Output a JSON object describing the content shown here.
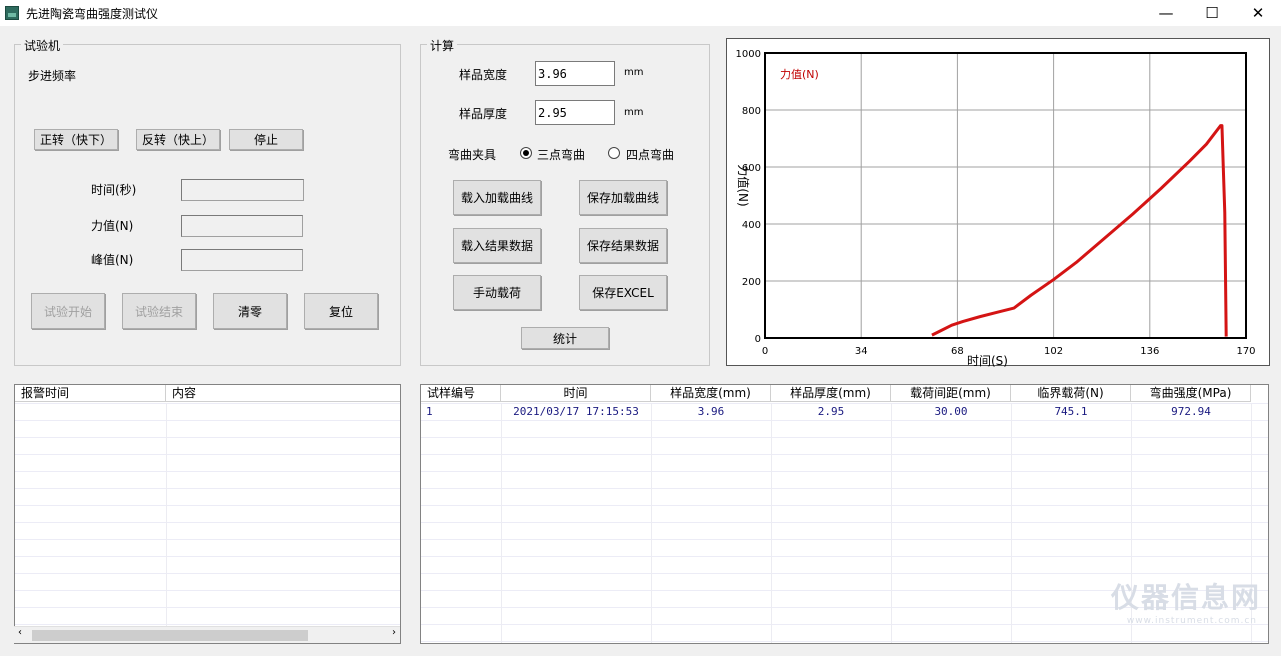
{
  "window": {
    "title": "先进陶瓷弯曲强度测试仪",
    "minimize": "—",
    "maximize": "☐",
    "close": "✕"
  },
  "machine": {
    "group_title": "试验机",
    "step_freq_label": "步进频率",
    "fwd_button": "正转（快下）",
    "rev_button": "反转（快上）",
    "stop_button": "停止",
    "time_label": "时间(秒)",
    "force_label": "力值(N)",
    "peak_label": "峰值(N)",
    "start_button": "试验开始",
    "end_button": "试验结束",
    "zero_button": "清零",
    "reset_button": "复位"
  },
  "calc": {
    "group_title": "计算",
    "width_label": "样品宽度",
    "width_value": "3.96",
    "thickness_label": "样品厚度",
    "thickness_value": "2.95",
    "unit": "mm",
    "fixture_label": "弯曲夹具",
    "three_point": "三点弯曲",
    "four_point": "四点弯曲",
    "load_curve_button": "载入加载曲线",
    "save_curve_button": "保存加载曲线",
    "load_result_button": "载入结果数据",
    "save_result_button": "保存结果数据",
    "manual_load_button": "手动载荷",
    "save_excel_button": "保存EXCEL",
    "stats_button": "统计"
  },
  "colors": {
    "curve": "#d41414",
    "legend": "#c00000"
  },
  "chart_data": {
    "type": "line",
    "legend": "力值(N)",
    "xlabel": "时间(S)",
    "ylabel": "力值(N)",
    "xlim": [
      0,
      170
    ],
    "ylim": [
      0,
      1000
    ],
    "x_ticks": [
      "0",
      "34",
      "68",
      "102",
      "136",
      "170"
    ],
    "y_ticks": [
      "0",
      "200",
      "400",
      "600",
      "800",
      "1000"
    ],
    "grid": true,
    "series": [
      {
        "name": "力值(N)",
        "x": [
          59,
          62,
          66,
          70,
          76,
          82,
          88,
          94,
          102,
          110,
          120,
          130,
          140,
          150,
          156,
          161,
          161.5,
          162,
          162.5,
          163
        ],
        "y": [
          10,
          25,
          45,
          58,
          75,
          90,
          105,
          150,
          205,
          265,
          350,
          435,
          525,
          620,
          680,
          745,
          745,
          590,
          440,
          5
        ]
      }
    ]
  },
  "alarm_table": {
    "headers": [
      "报警时间",
      "内容"
    ]
  },
  "result_table": {
    "headers": [
      "试样编号",
      "时间",
      "样品宽度(mm)",
      "样品厚度(mm)",
      "载荷间距(mm)",
      "临界载荷(N)",
      "弯曲强度(MPa)"
    ],
    "rows": [
      [
        "1",
        "2021/03/17 17:15:53",
        "3.96",
        "2.95",
        "30.00",
        "745.1",
        "972.94"
      ]
    ]
  },
  "watermark": {
    "text": "仪器信息网",
    "sub": "www.instrument.com.cn"
  }
}
